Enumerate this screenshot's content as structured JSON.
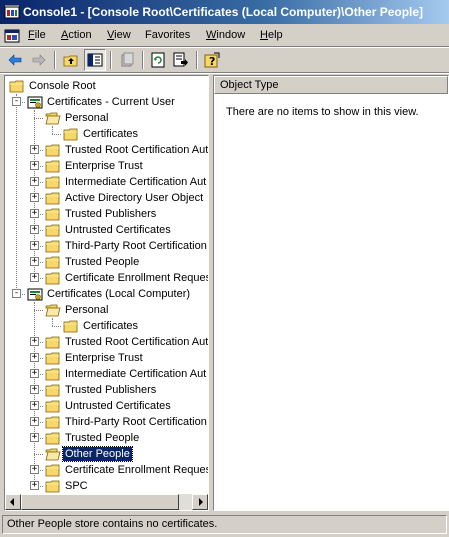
{
  "window": {
    "title": "Console1 - [Console Root\\Certificates (Local Computer)\\Other People]",
    "icon": "mmc-console-icon"
  },
  "menu": {
    "items": [
      {
        "label": "File",
        "accel": "F",
        "rest": "ile"
      },
      {
        "label": "Action",
        "accel": "A",
        "rest": "ction"
      },
      {
        "label": "View",
        "accel": "V",
        "rest": "iew"
      },
      {
        "label": "Favorites",
        "accel": "",
        "rest": "Favorites"
      },
      {
        "label": "Window",
        "accel": "W",
        "rest": "indow"
      },
      {
        "label": "Help",
        "accel": "H",
        "rest": "elp"
      }
    ]
  },
  "toolbar": {
    "buttons": [
      "back-arrow-icon",
      "forward-arrow-icon",
      "up-one-level-icon",
      "show-hide-tree-icon",
      "delete-icon",
      "refresh-icon",
      "export-list-icon",
      "help-icon"
    ]
  },
  "tree": {
    "root": "Console Root",
    "user_store": "Certificates - Current User",
    "user_children": [
      "Personal",
      "Certificates",
      "Trusted Root Certification Aut",
      "Enterprise Trust",
      "Intermediate Certification Aut",
      "Active Directory User Object",
      "Trusted Publishers",
      "Untrusted Certificates",
      "Third-Party Root Certification",
      "Trusted People",
      "Certificate Enrollment Reques"
    ],
    "computer_store": "Certificates (Local Computer)",
    "computer_children": [
      "Personal",
      "Certificates",
      "Trusted Root Certification Aut",
      "Enterprise Trust",
      "Intermediate Certification Aut",
      "Trusted Publishers",
      "Untrusted Certificates",
      "Third-Party Root Certification",
      "Trusted People",
      "Other People",
      "Certificate Enrollment Reques",
      "SPC"
    ],
    "selected": "Other People"
  },
  "list": {
    "column": "Object Type",
    "empty_message": "There are no items to show in this view."
  },
  "status": {
    "text": "Other People store contains no certificates."
  },
  "colors": {
    "titlebar_start": "#0a246a",
    "titlebar_end": "#a6caf0",
    "face": "#d4d0c8",
    "selection": "#0a246a",
    "folder": "#f6d86a"
  }
}
